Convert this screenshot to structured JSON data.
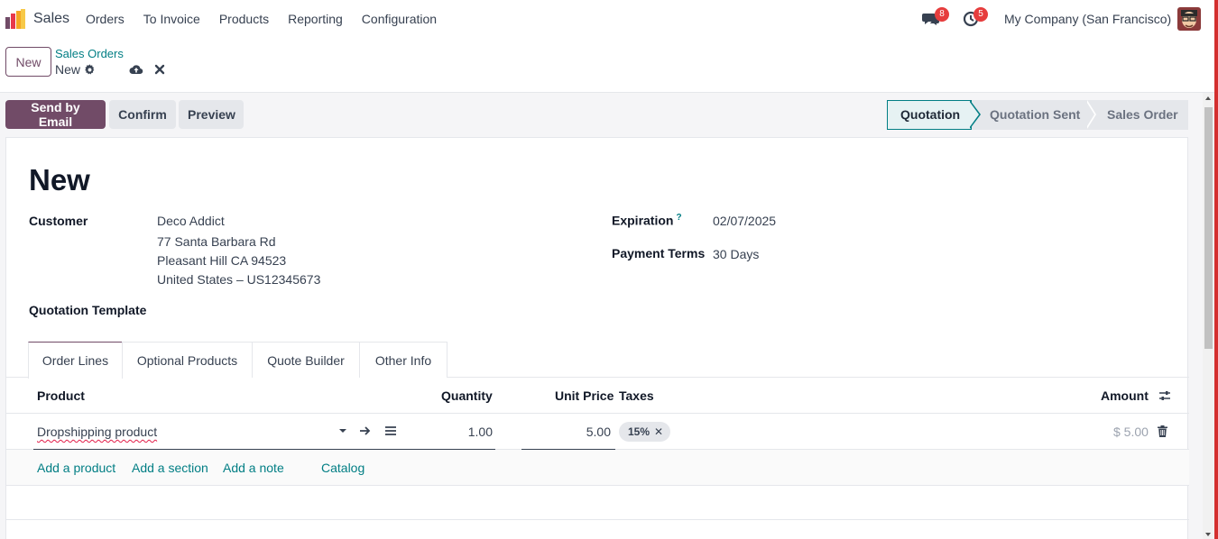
{
  "nav": {
    "app_name": "Sales",
    "menu": [
      "Orders",
      "To Invoice",
      "Products",
      "Reporting",
      "Configuration"
    ],
    "messages_count": "8",
    "activities_count": "5",
    "company": "My Company (San Francisco)"
  },
  "control": {
    "new_label": "New",
    "breadcrumb_parent": "Sales Orders",
    "breadcrumb_current": "New"
  },
  "actions": {
    "send_by_email": "Send by Email",
    "confirm": "Confirm",
    "preview": "Preview"
  },
  "status": {
    "stages": [
      "Quotation",
      "Quotation Sent",
      "Sales Order"
    ],
    "active": "Quotation"
  },
  "form": {
    "title": "New",
    "customer_label": "Customer",
    "customer_name": "Deco Addict",
    "customer_address": [
      "77 Santa Barbara Rd",
      "Pleasant Hill CA 94523",
      "United States – US12345673"
    ],
    "quotation_template_label": "Quotation Template",
    "expiration_label": "Expiration",
    "expiration_help": "?",
    "expiration_value": "02/07/2025",
    "payment_terms_label": "Payment Terms",
    "payment_terms_value": "30 Days"
  },
  "tabs": [
    "Order Lines",
    "Optional Products",
    "Quote Builder",
    "Other Info"
  ],
  "order_lines": {
    "headers": {
      "product": "Product",
      "quantity": "Quantity",
      "unit_price": "Unit Price",
      "taxes": "Taxes",
      "amount": "Amount"
    },
    "rows": [
      {
        "product": "Dropshipping product",
        "quantity": "1.00",
        "unit_price": "5.00",
        "tax": "15%",
        "amount": "$ 5.00"
      }
    ],
    "add_links": {
      "add_product": "Add a product",
      "add_section": "Add a section",
      "add_note": "Add a note",
      "catalog": "Catalog"
    }
  },
  "colors": {
    "brand": "#714b67",
    "accent": "#017e84",
    "badge": "#e63d3d"
  }
}
